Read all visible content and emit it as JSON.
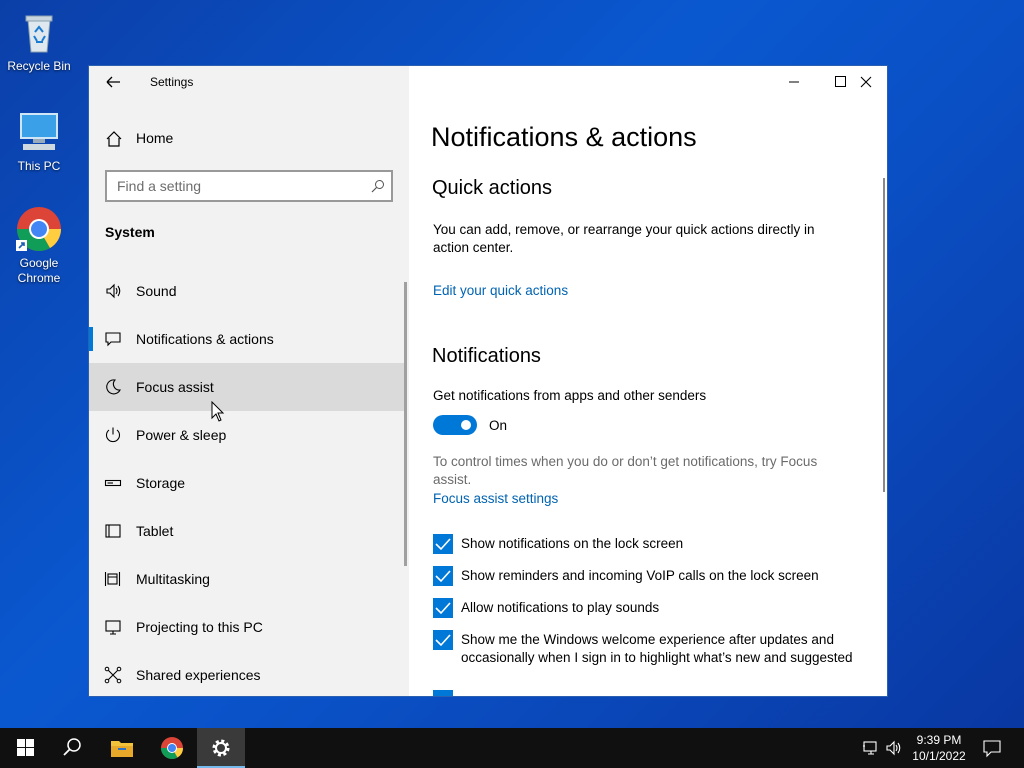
{
  "desktop": {
    "icons": [
      {
        "label": "Recycle Bin"
      },
      {
        "label": "This PC"
      },
      {
        "label": "Google Chrome"
      }
    ]
  },
  "window": {
    "title": "Settings",
    "sidebar": {
      "home_label": "Home",
      "search_placeholder": "Find a setting",
      "section": "System",
      "items": [
        {
          "label": "Sound",
          "icon": "speaker-icon"
        },
        {
          "label": "Notifications & actions",
          "icon": "message-icon",
          "selected": true
        },
        {
          "label": "Focus assist",
          "icon": "moon-icon",
          "hovered": true
        },
        {
          "label": "Power & sleep",
          "icon": "power-icon"
        },
        {
          "label": "Storage",
          "icon": "storage-icon"
        },
        {
          "label": "Tablet",
          "icon": "tablet-icon"
        },
        {
          "label": "Multitasking",
          "icon": "multitasking-icon"
        },
        {
          "label": "Projecting to this PC",
          "icon": "projector-icon"
        },
        {
          "label": "Shared experiences",
          "icon": "share-icon"
        }
      ]
    },
    "content": {
      "title": "Notifications & actions",
      "quick_actions": {
        "heading": "Quick actions",
        "description": "You can add, remove, or rearrange your quick actions directly in action center.",
        "link": "Edit your quick actions"
      },
      "notifications": {
        "heading": "Notifications",
        "get_label": "Get notifications from apps and other senders",
        "toggle_state": "On",
        "focus_hint": "To control times when you do or don’t get notifications, try Focus assist.",
        "focus_link": "Focus assist settings",
        "checkboxes": [
          {
            "label": "Show notifications on the lock screen",
            "checked": true
          },
          {
            "label": "Show reminders and incoming VoIP calls on the lock screen",
            "checked": true
          },
          {
            "label": "Allow notifications to play sounds",
            "checked": true
          },
          {
            "label": "Show me the Windows welcome experience after updates and occasionally when I sign in to highlight what’s new and suggested",
            "checked": true
          }
        ]
      }
    }
  },
  "taskbar": {
    "time": "9:39 PM",
    "date": "10/1/2022"
  },
  "colors": {
    "accent": "#0078d7",
    "link": "#0063b1",
    "sidebar_bg": "#f2f2f2",
    "hover_bg": "#dadada"
  }
}
